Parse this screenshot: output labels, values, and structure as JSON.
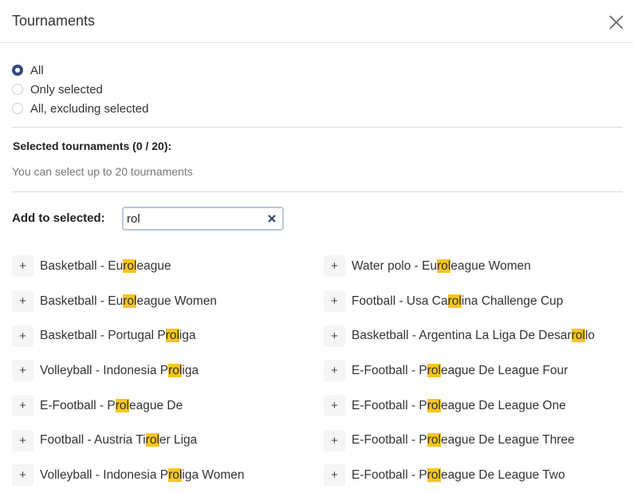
{
  "dialog": {
    "title": "Tournaments"
  },
  "filter": {
    "options": [
      {
        "label": "All",
        "checked": true
      },
      {
        "label": "Only selected",
        "checked": false
      },
      {
        "label": "All, excluding selected",
        "checked": false
      }
    ]
  },
  "selected": {
    "heading": "Selected tournaments (0 / 20):",
    "hint": "You can select up to 20 tournaments"
  },
  "add": {
    "label": "Add to selected:",
    "search_value": "rol"
  },
  "colors": {
    "highlight": "#f7c51e",
    "accent": "#34487c"
  },
  "results": [
    {
      "label": "Basketball - Euroleague"
    },
    {
      "label": "Water polo - Euroleague Women"
    },
    {
      "label": "Basketball - Euroleague Women"
    },
    {
      "label": "Football - Usa Carolina Challenge Cup"
    },
    {
      "label": "Basketball - Portugal Proliga"
    },
    {
      "label": "Basketball - Argentina La Liga De Desarrollo"
    },
    {
      "label": "Volleyball - Indonesia Proliga"
    },
    {
      "label": "E-Football - Proleague De League Four"
    },
    {
      "label": "E-Football - Proleague De"
    },
    {
      "label": "E-Football - Proleague De League One"
    },
    {
      "label": "Football - Austria Tiroler Liga"
    },
    {
      "label": "E-Football - Proleague De League Three"
    },
    {
      "label": "Volleyball - Indonesia Proliga Women"
    },
    {
      "label": "E-Football - Proleague De League Two"
    }
  ]
}
